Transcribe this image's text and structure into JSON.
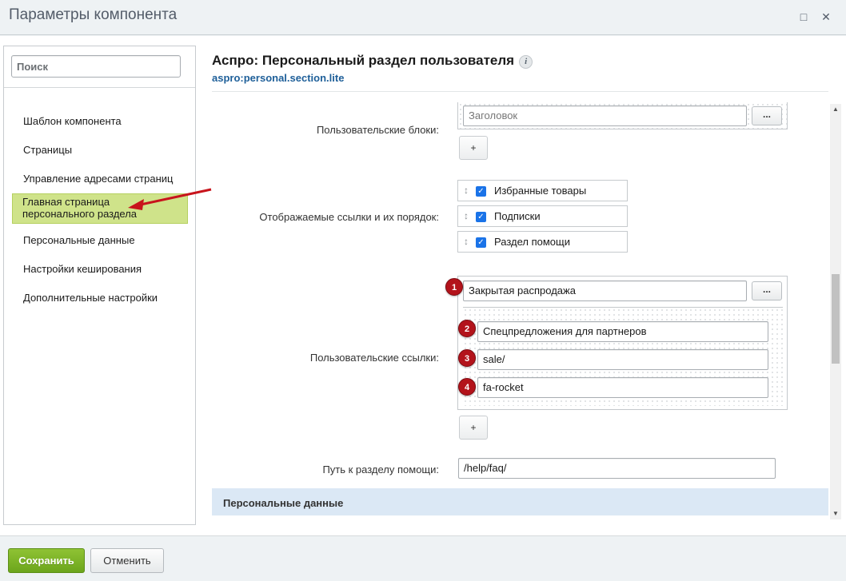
{
  "window": {
    "title": "Параметры компонента",
    "maximize_icon": "maximize-icon",
    "close_icon": "close-icon"
  },
  "sidebar": {
    "search_placeholder": "Поиск",
    "items": [
      {
        "label": "Шаблон компонента",
        "active": false
      },
      {
        "label": "Страницы",
        "active": false
      },
      {
        "label": "Управление адресами страниц",
        "active": false
      },
      {
        "label": "Главная страница персонального раздела",
        "active": true
      },
      {
        "label": "Персональные данные",
        "active": false
      },
      {
        "label": "Настройки кеширования",
        "active": false
      },
      {
        "label": "Дополнительные настройки",
        "active": false
      }
    ]
  },
  "component": {
    "title": "Аспро: Персональный раздел пользователя",
    "code": "aspro:personal.section.lite",
    "info_icon_glyph": "i"
  },
  "params": {
    "user_blocks": {
      "label": "Пользовательские блоки:",
      "field_placeholder": "Заголовок",
      "dots_label": "...",
      "plus_label": "+"
    },
    "displayed_links": {
      "label": "Отображаемые ссылки и их порядок:",
      "items": [
        {
          "label": "Избранные товары",
          "checked": true
        },
        {
          "label": "Подписки",
          "checked": true
        },
        {
          "label": "Раздел помощи",
          "checked": true
        }
      ]
    },
    "user_links": {
      "label": "Пользовательские ссылки:",
      "title_value": "Закрытая распродажа",
      "dots_label": "...",
      "name_value": "Спецпредложения для партнеров",
      "url_value": "sale/",
      "icon_value": "fa-rocket",
      "plus_label": "+",
      "badges": [
        "1",
        "2",
        "3",
        "4"
      ]
    },
    "help_path": {
      "label": "Путь к разделу помощи:",
      "value": "/help/faq/"
    }
  },
  "section_header": "Персональные данные",
  "footer": {
    "save_label": "Сохранить",
    "cancel_label": "Отменить"
  },
  "colors": {
    "save_button": "#7ab42a",
    "active_item": "#cfe38a",
    "badge": "#b3131b",
    "annotation_arrow": "#c8141c",
    "section_bar": "#dbe8f5",
    "code_link": "#1e5f99"
  }
}
